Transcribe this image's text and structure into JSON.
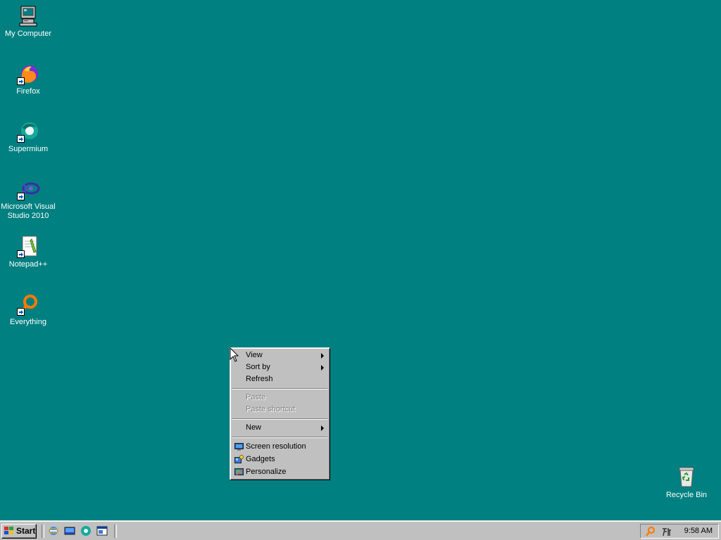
{
  "desktop": {
    "background_color": "#008080",
    "icons": [
      {
        "label": "My Computer",
        "icon": "computer-icon"
      },
      {
        "label": "Firefox",
        "icon": "firefox-icon"
      },
      {
        "label": "Supermium",
        "icon": "supermium-icon"
      },
      {
        "label": "Microsoft Visual Studio 2010",
        "icon": "visual-studio-icon"
      },
      {
        "label": "Notepad++",
        "icon": "notepad-plus-plus-icon"
      },
      {
        "label": "Everything",
        "icon": "everything-search-icon"
      },
      {
        "label": "Recycle Bin",
        "icon": "recycle-bin-icon"
      }
    ]
  },
  "context_menu": {
    "items": [
      {
        "label": "View",
        "submenu": true,
        "enabled": true
      },
      {
        "label": "Sort by",
        "submenu": true,
        "enabled": true
      },
      {
        "label": "Refresh",
        "submenu": false,
        "enabled": true
      },
      {
        "label": "Paste",
        "submenu": false,
        "enabled": false
      },
      {
        "label": "Paste shortcut",
        "submenu": false,
        "enabled": false
      },
      {
        "label": "New",
        "submenu": true,
        "enabled": true
      },
      {
        "label": "Screen resolution",
        "icon": "display-icon",
        "enabled": true
      },
      {
        "label": "Gadgets",
        "icon": "gadgets-icon",
        "enabled": true
      },
      {
        "label": "Personalize",
        "icon": "personalize-icon",
        "enabled": true
      }
    ]
  },
  "taskbar": {
    "start_label": "Start",
    "quick_launch": [
      "internet-explorer-icon",
      "show-desktop-icon",
      "supermium-icon",
      "window-switcher-icon"
    ],
    "tray": {
      "icons": [
        "everything-search-icon",
        "input-method-icon"
      ],
      "clock": "9:58 AM"
    }
  }
}
